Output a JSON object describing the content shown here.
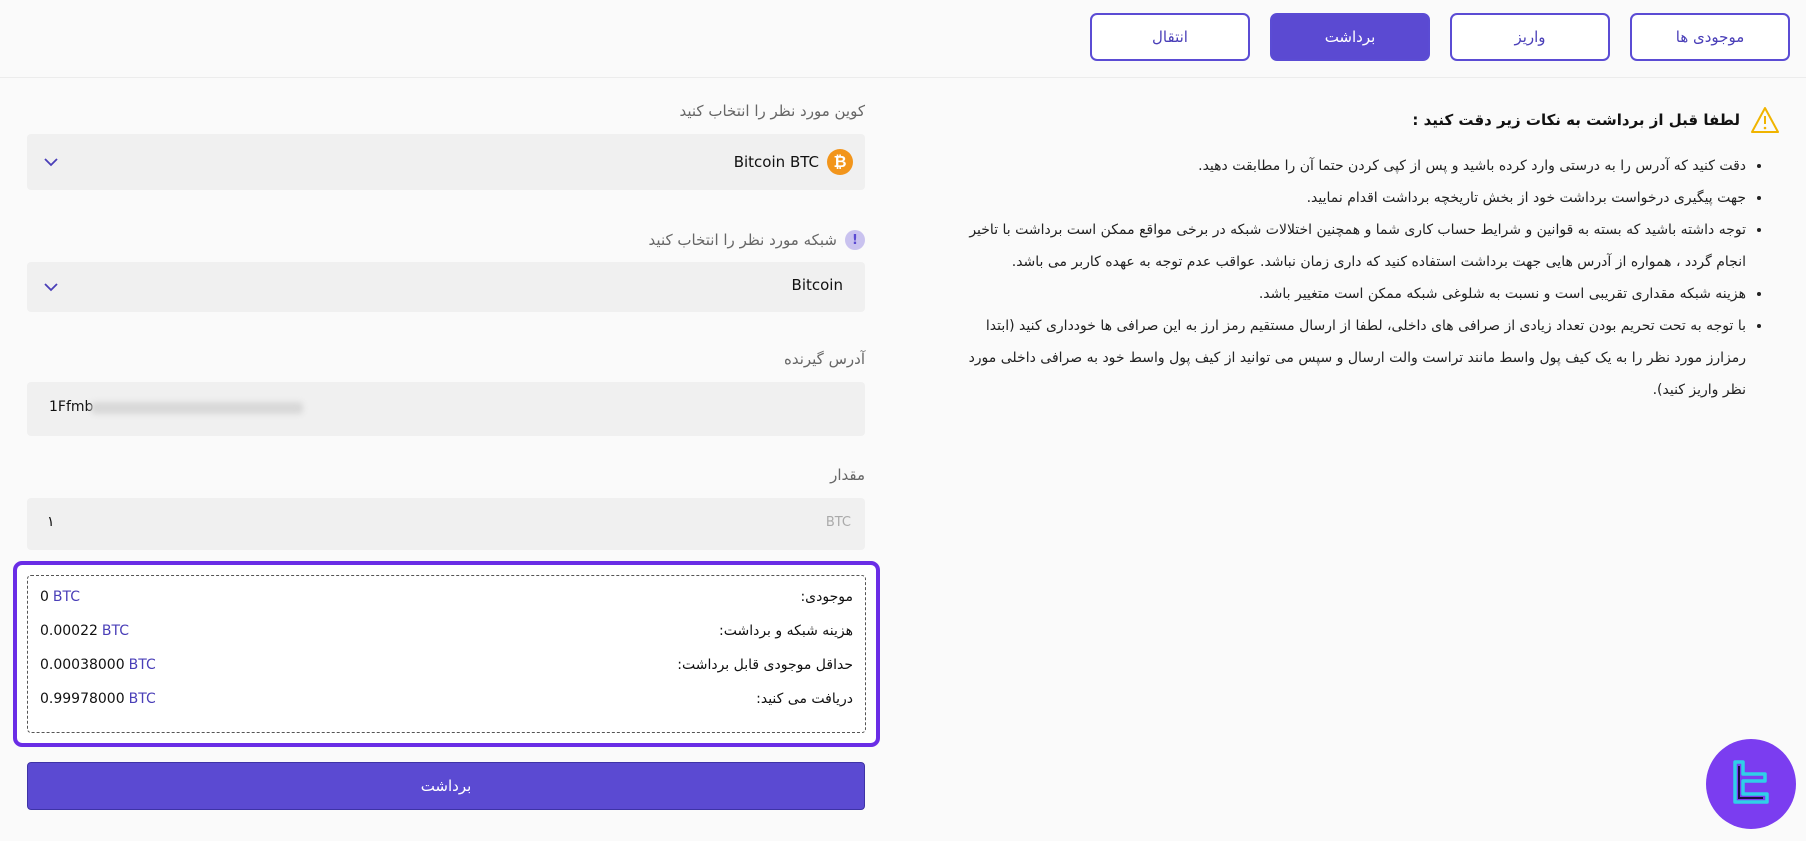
{
  "tabs": [
    {
      "label": "موجودی ها",
      "active": false
    },
    {
      "label": "واریز",
      "active": false
    },
    {
      "label": "برداشت",
      "active": true
    },
    {
      "label": "انتقال",
      "active": false
    }
  ],
  "form": {
    "coin_label": "کوین مورد نظر را انتخاب کنید",
    "coin_name": "Bitcoin",
    "coin_symbol": "BTC",
    "network_label": "شبکه مورد نظر را انتخاب کنید",
    "network_value": "Bitcoin",
    "address_label": "آدرس گیرنده",
    "address_value": "1Ffmb",
    "amount_label": "مقدار",
    "amount_value": "۱",
    "amount_unit": "BTC"
  },
  "summary": {
    "balance_label": "موجودی:",
    "balance_value": "0",
    "fee_label": "هزینه شبکه و برداشت:",
    "fee_value": "0.00022",
    "min_label": "حداقل موجودی قابل برداشت:",
    "min_value": "0.00038000",
    "receive_label": "دریافت می کنید:",
    "receive_value": "0.99978000",
    "unit": "BTC"
  },
  "withdraw_button": "برداشت",
  "notes": {
    "title": "لطفا قبل از برداشت به نکات زیر دقت کنید :",
    "items": [
      "دقت کنید که آدرس را به درستی وارد کرده باشید و پس از کپی کردن حتما آن را مطابقت دهید.",
      "جهت پیگیری درخواست برداشت خود از بخش تاریخچه برداشت اقدام نمایید.",
      "توجه داشته باشید که بسته به قوانین و شرایط حساب کاری شما و همچنین اختلالات شبکه در برخی مواقع ممکن است برداشت با تاخیر انجام گردد ، همواره از آدرس هایی جهت برداشت استفاده کنید که داری زمان نباشد. عواقب عدم توجه به عهده کاربر می باشد.",
      "هزینه شبکه مقداری تقریبی است و نسبت به شلوغی شبکه ممکن است متغییر باشد.",
      "با توجه به تحت تحریم بودن تعداد زیادی از صرافی های داخلی، لطفا از ارسال مستقیم رمز ارز به این صرافی ها خودداری کنید (ابتدا رمزارز مورد نظر را به یک کیف پول واسط مانند تراست والت ارسال و سپس می توانید از کیف پول واسط خود به صرافی داخلی مورد نظر واریز کنید)."
    ]
  },
  "colors": {
    "accent": "#5b4ad2",
    "highlight_border": "#6a2de6",
    "btc_orange": "#f2951b"
  },
  "icons": [
    "bitcoin-icon",
    "chevron-down-icon",
    "info-icon",
    "warning-icon",
    "brand-logo-icon"
  ]
}
